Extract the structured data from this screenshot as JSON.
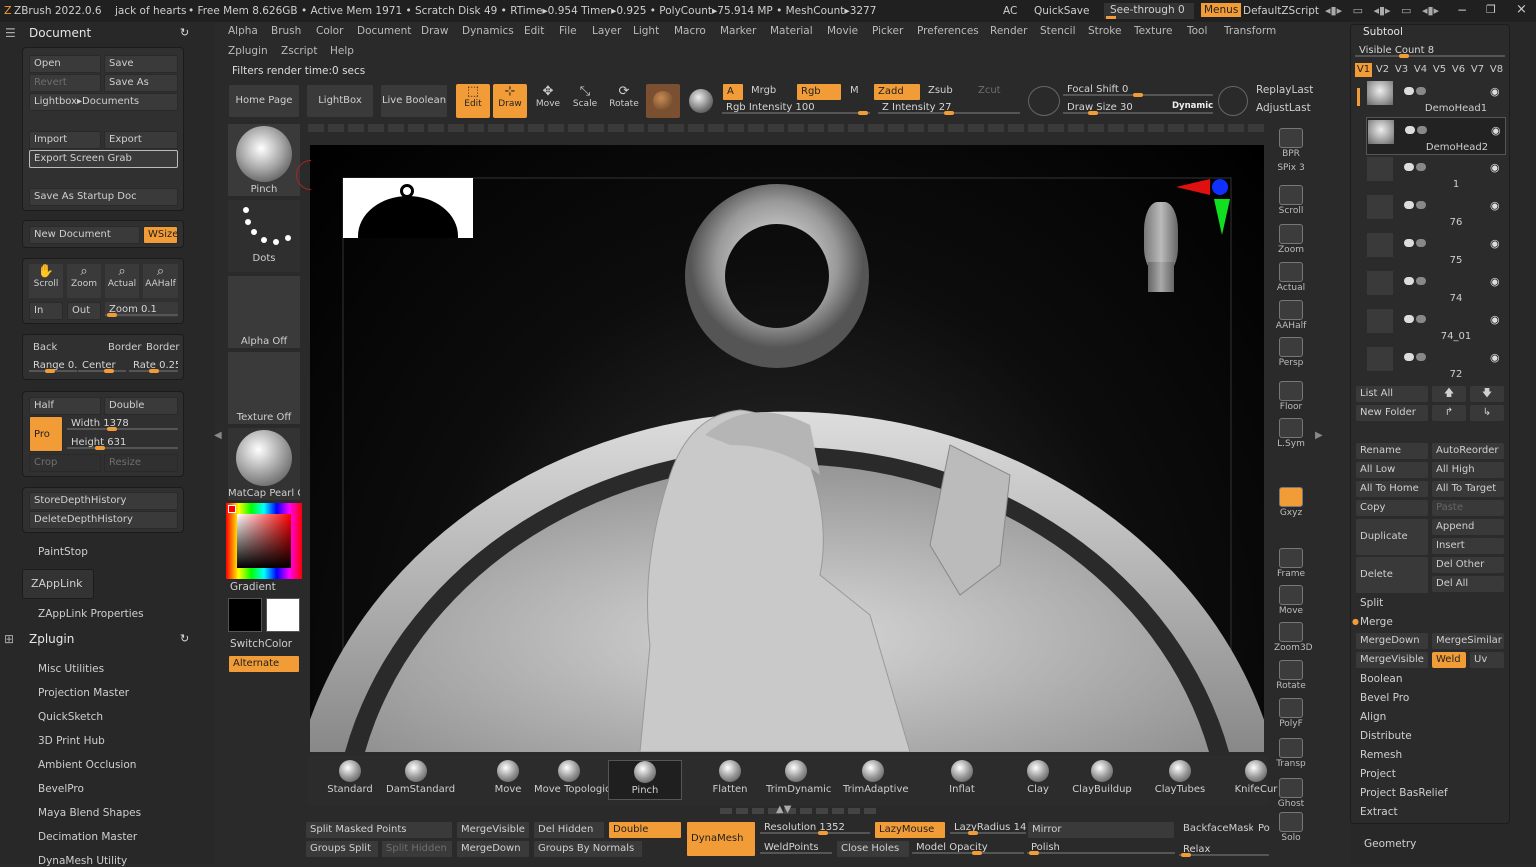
{
  "titlebar": {
    "app": "ZBrush 2022.0.6",
    "doc": "jack of hearts",
    "stats": "• Free Mem 8.626GB • Active Mem 1971 • Scratch Disk 49 •  RTime▸0.954 Timer▸0.925 • PolyCount▸75.914 MP  • MeshCount▸3277",
    "ac": "AC",
    "quicksave": "QuickSave",
    "seethrough": "See-through  0",
    "menus": "Menus",
    "defaultzscript": "DefaultZScript"
  },
  "menubar": [
    "Alpha",
    "Brush",
    "Color",
    "Document",
    "Draw",
    "Dynamics",
    "Edit",
    "File",
    "Layer",
    "Light",
    "Macro",
    "Marker",
    "Material",
    "Movie",
    "Picker",
    "Preferences",
    "Render",
    "Stencil",
    "Stroke",
    "Texture",
    "Tool",
    "Transform"
  ],
  "menubar2": [
    "Zplugin",
    "Zscript",
    "Help"
  ],
  "status": "Filters render time:0 secs",
  "leftpanel": {
    "title": "Document",
    "open": "Open",
    "save": "Save",
    "revert": "Revert",
    "saveas": "Save As",
    "lightbox": "Lightbox▸Documents",
    "import": "Import",
    "export": "Export",
    "exportgrab": "Export Screen Grab",
    "startup": "Save As Startup Doc",
    "newdoc": "New Document",
    "wsize": "WSize",
    "scroll": "Scroll",
    "zoom": "Zoom",
    "actual": "Actual",
    "aahalf": "AAHalf",
    "in": "In",
    "out": "Out",
    "zoomval": "Zoom 0.1",
    "back": "Back",
    "border1": "Border",
    "border2": "Border",
    "range": "Range 0.",
    "center": "Center",
    "rate": "Rate 0.25",
    "half": "Half",
    "double": "Double",
    "pro": "Pro",
    "width": "Width 1378",
    "height": "Height 631",
    "crop": "Crop",
    "resize": "Resize",
    "storedepth": "StoreDepthHistory",
    "deletedepth": "DeleteDepthHistory",
    "paintstop": "PaintStop",
    "zapplink": "ZAppLink",
    "zapplinkprops": "ZAppLink Properties",
    "zplugin": "Zplugin",
    "plugins": [
      "Misc Utilities",
      "Projection Master",
      "QuickSketch",
      "3D Print Hub",
      "Ambient Occlusion",
      "BevelPro",
      "Maya Blend Shapes",
      "Decimation Master",
      "DynaMesh Utility"
    ]
  },
  "shelf": {
    "homepage": "Home Page",
    "lightbox": "LightBox",
    "liveboolean": "Live Boolean",
    "edit": "Edit",
    "draw": "Draw",
    "move": "Move",
    "scale": "Scale",
    "rotate": "Rotate",
    "a": "A",
    "mrgb": "Mrgb",
    "rgb": "Rgb",
    "m": "M",
    "zadd": "Zadd",
    "zsub": "Zsub",
    "zcut": "Zcut",
    "rgbint": "Rgb Intensity 100",
    "zint": "Z Intensity 27",
    "focal": "Focal Shift 0",
    "drawsize": "Draw Size 30",
    "dynamic": "Dynamic",
    "replaylast": "ReplayLast",
    "adjustlast": "AdjustLast"
  },
  "tray": {
    "pinch": "Pinch",
    "dots": "Dots",
    "alphaoff": "Alpha Off",
    "textureoff": "Texture Off",
    "matcap": "MatCap Pearl C",
    "gradient": "Gradient",
    "switchcolor": "SwitchColor",
    "alternate": "Alternate"
  },
  "vtools": [
    "BPR",
    "SPix 3",
    "Scroll",
    "Zoom",
    "Actual",
    "AAHalf",
    "Persp",
    "Floor",
    "L.Sym",
    "Gxyz",
    "Frame",
    "Move",
    "Zoom3D",
    "Rotate",
    "PolyF",
    "Transp",
    "Ghost",
    "Solo"
  ],
  "brushes": [
    "Standard",
    "DamStandard",
    "Move",
    "Move Topologic",
    "Pinch",
    "Flatten",
    "TrimDynamic",
    "TrimAdaptive",
    "Inflat",
    "Clay",
    "ClayBuildup",
    "ClayTubes",
    "KnifeCur"
  ],
  "bottom": {
    "splitmasked": "Split Masked Points",
    "mergevisible": "MergeVisible",
    "delhidden": "Del Hidden",
    "double": "Double",
    "groupssplit": "Groups Split",
    "splithidden": "Split Hidden",
    "mergedown": "MergeDown",
    "groupsnormals": "Groups By Normals",
    "dynamesh": "DynaMesh",
    "resolution": "Resolution 1352",
    "lazymouse": "LazyMouse",
    "lazyradius": "LazyRadius 14",
    "weldpoints": "WeldPoints",
    "closeholes": "Close Holes",
    "modelopacity": "Model Opacity",
    "mirror": "Mirror",
    "polish": "Polish",
    "backfacemask": "BackfaceMask",
    "relax": "Relax",
    "po": "Po"
  },
  "subtool": {
    "title": "Subtool",
    "visiblecount": "Visible Count 8",
    "tabs": [
      "V1",
      "V2",
      "V3",
      "V4",
      "V5",
      "V6",
      "V7",
      "V8"
    ],
    "items": [
      "DemoHead1",
      "DemoHead2",
      "1",
      "76",
      "75",
      "74",
      "74_01",
      "72"
    ],
    "listall": "List All",
    "newfolder": "New Folder",
    "rename": "Rename",
    "autoreorder": "AutoReorder",
    "alllow": "All Low",
    "allhigh": "All High",
    "alltohome": "All To Home",
    "alltotarget": "All To Target",
    "copy": "Copy",
    "paste": "Paste",
    "duplicate": "Duplicate",
    "append": "Append",
    "insert": "Insert",
    "delete": "Delete",
    "delother": "Del Other",
    "delall": "Del All",
    "split": "Split",
    "merge": "Merge",
    "mergedown": "MergeDown",
    "mergesimilar": "MergeSimilar",
    "mergevisible": "MergeVisible",
    "weld": "Weld",
    "uv": "Uv",
    "sections": [
      "Boolean",
      "Bevel Pro",
      "Align",
      "Distribute",
      "Remesh",
      "Project",
      "Project BasRelief",
      "Extract"
    ],
    "geometry": "Geometry"
  },
  "colors": {
    "accent": "#f29c38",
    "panel": "#282828",
    "button": "#3a3a3a"
  }
}
